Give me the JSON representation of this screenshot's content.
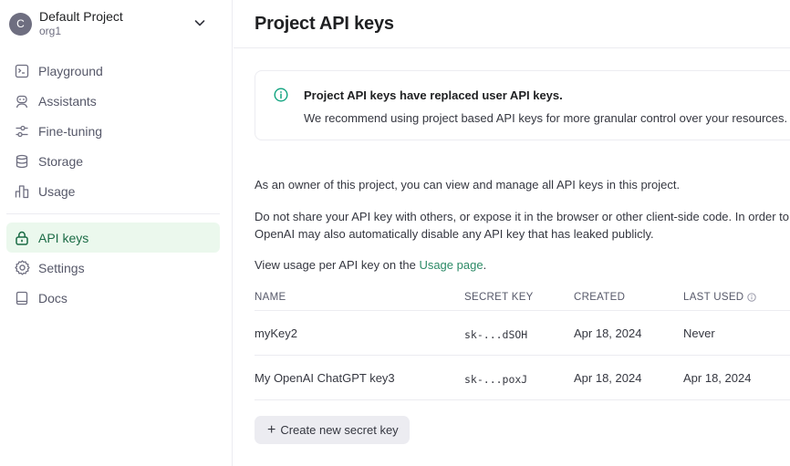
{
  "project": {
    "avatar_letter": "C",
    "name": "Default Project",
    "org": "org1"
  },
  "sidebar": {
    "items": [
      {
        "label": "Playground",
        "icon": "terminal-icon"
      },
      {
        "label": "Assistants",
        "icon": "robot-icon"
      },
      {
        "label": "Fine-tuning",
        "icon": "sliders-icon"
      },
      {
        "label": "Storage",
        "icon": "database-icon"
      },
      {
        "label": "Usage",
        "icon": "bar-chart-icon"
      }
    ],
    "items2": [
      {
        "label": "API keys",
        "icon": "lock-icon",
        "active": true
      },
      {
        "label": "Settings",
        "icon": "gear-icon"
      },
      {
        "label": "Docs",
        "icon": "book-icon"
      }
    ]
  },
  "header": {
    "title": "Project API keys"
  },
  "notice": {
    "title": "Project API keys have replaced user API keys.",
    "body": "We recommend using project based API keys for more granular control over your resources."
  },
  "paragraphs": {
    "owner": "As an owner of this project, you can view and manage all API keys in this project.",
    "share_line1": "Do not share your API key with others, or expose it in the browser or other client-side code. In order to protect the security of your account,",
    "share_line2": "OpenAI may also automatically disable any API key that has leaked publicly.",
    "usage_prefix": "View usage per API key on the ",
    "usage_link": "Usage page",
    "usage_suffix": "."
  },
  "table": {
    "columns": [
      "NAME",
      "SECRET KEY",
      "CREATED",
      "LAST USED"
    ],
    "rows": [
      {
        "name": "myKey2",
        "secret": "sk-...dSOH",
        "created": "Apr 18, 2024",
        "last_used": "Never"
      },
      {
        "name": "My OpenAI ChatGPT key3",
        "secret": "sk-...poxJ",
        "created": "Apr 18, 2024",
        "last_used": "Apr 18, 2024"
      }
    ]
  },
  "actions": {
    "create_label": "Create new secret key"
  },
  "colors": {
    "accent": "#10a37f",
    "active_bg": "#ebf8ed",
    "active_text": "#1b6b45"
  }
}
